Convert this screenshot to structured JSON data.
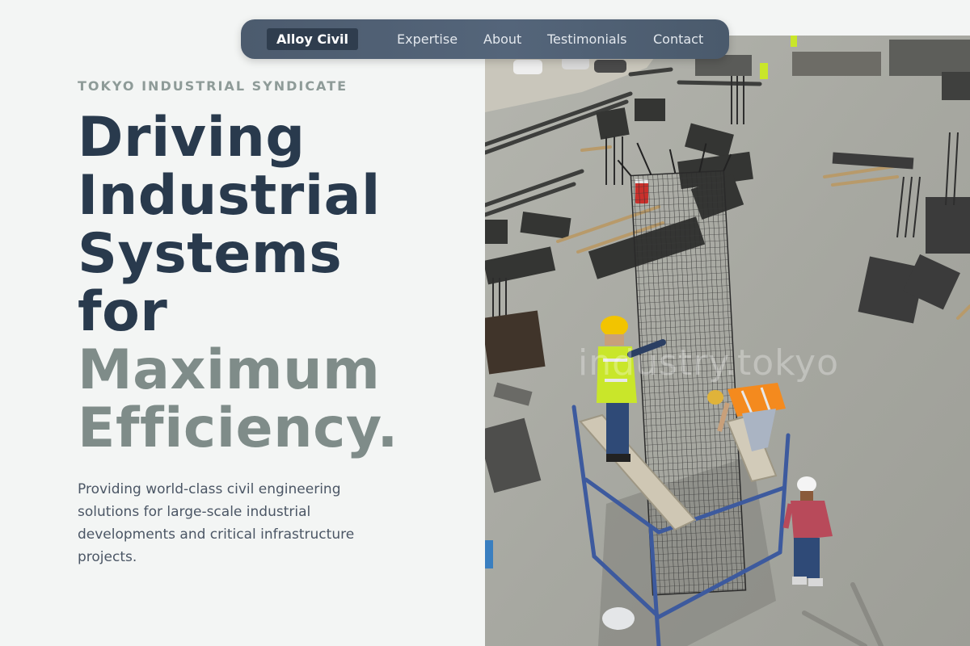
{
  "nav": {
    "brand": "Alloy Civil",
    "links": [
      "Expertise",
      "About",
      "Testimonials",
      "Contact"
    ]
  },
  "hero": {
    "eyebrow": "TOKYO INDUSTRIAL SYNDICATE",
    "headline_lines": [
      "Driving",
      "Industrial",
      "Systems",
      "for"
    ],
    "headline_accent_lines": [
      "Maximum",
      "Efficiency."
    ],
    "description": "Providing world-class civil engineering solutions for large-scale industrial developments and critical infrastructure projects.",
    "image_watermark": "industry.tokyo"
  },
  "colors": {
    "background": "#f3f5f4",
    "nav_bg": "#4f5f73",
    "brand_bg": "#2f3d4e",
    "headline": "#293a4d",
    "headline_accent": "#7f8c89",
    "eyebrow": "#8e9b98",
    "body_text": "#4b5665"
  }
}
